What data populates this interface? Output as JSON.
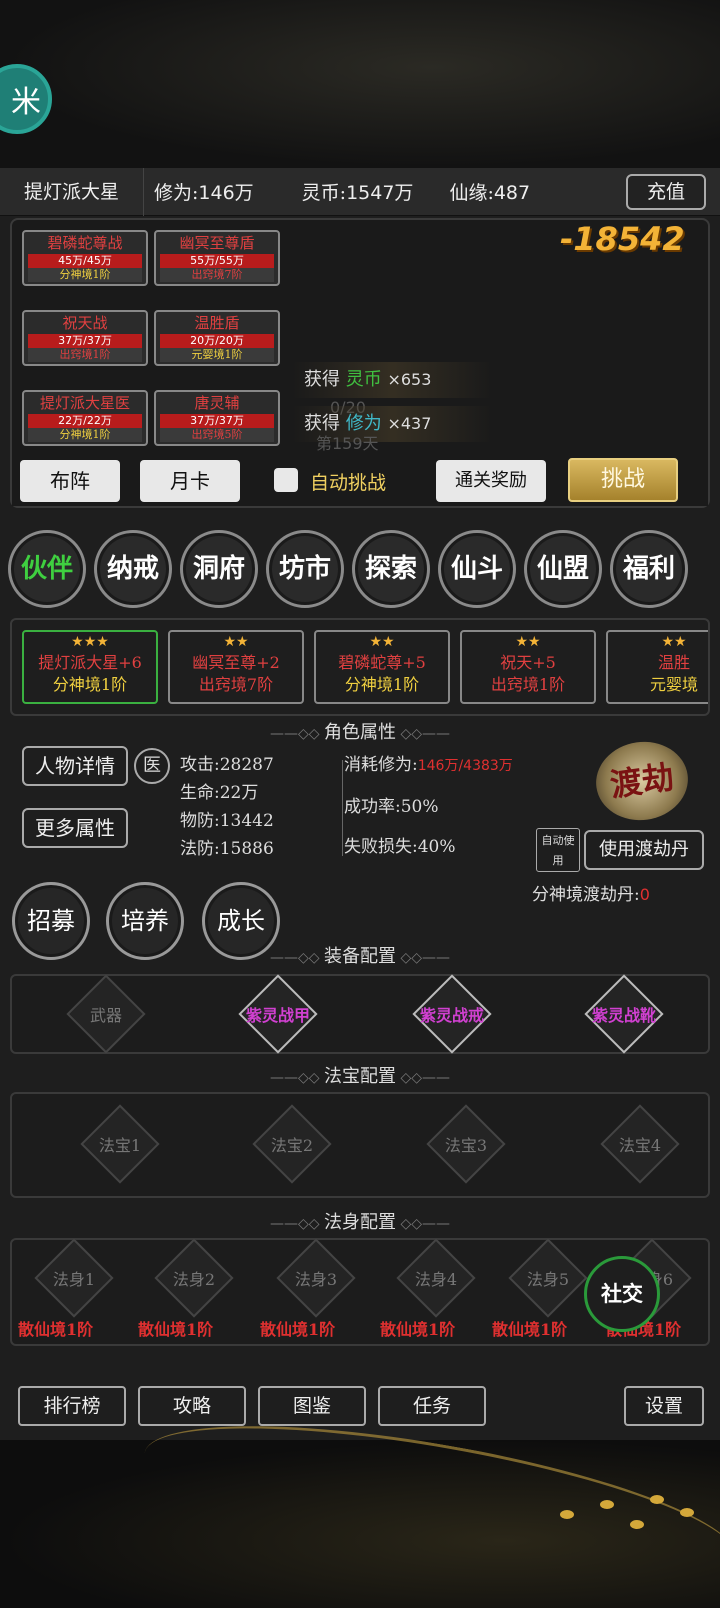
{
  "topbar": {
    "name": "提灯派大星",
    "cultivation_label": "修为:",
    "cultivation": "146万",
    "coins_label": "灵币:",
    "coins": "1547万",
    "luck_label": "仙缘:",
    "luck": "487",
    "recharge": "充值"
  },
  "battle": {
    "damage": "-18542",
    "units": [
      {
        "name": "碧磷蛇尊战",
        "hp": "45万/45万",
        "rank": "分神境1阶"
      },
      {
        "name": "幽冥至尊盾",
        "hp": "55万/55万",
        "rank": "出窍境7阶"
      },
      {
        "name": "祝天战",
        "hp": "37万/37万",
        "rank": "出窍境1阶"
      },
      {
        "name": "温胜盾",
        "hp": "20万/20万",
        "rank": "元婴境1阶"
      },
      {
        "name": "提灯派大星医",
        "hp": "22万/22万",
        "rank": "分神境1阶"
      },
      {
        "name": "唐灵辅",
        "hp": "37万/37万",
        "rank": "出窍境5阶"
      }
    ],
    "gains": [
      {
        "prefix": "获得",
        "res": "灵币",
        "amount": "×653"
      },
      {
        "prefix": "获得",
        "res": "修为",
        "amount": "×437"
      }
    ],
    "progress": "0/20",
    "day": "第159天",
    "formation": "布阵",
    "monthcard": "月卡",
    "auto_challenge": "自动挑战",
    "clear_reward": "通关奖励",
    "challenge": "挑战"
  },
  "nav": [
    "伙伴",
    "纳戒",
    "洞府",
    "坊市",
    "探索",
    "仙斗",
    "仙盟",
    "福利"
  ],
  "partners": [
    {
      "stars": "★★★",
      "name": "提灯派大星+6",
      "rank": "分神境1阶"
    },
    {
      "stars": "★★",
      "name": "幽冥至尊+2",
      "rank": "出窍境7阶"
    },
    {
      "stars": "★★",
      "name": "碧磷蛇尊+5",
      "rank": "分神境1阶"
    },
    {
      "stars": "★★",
      "name": "祝天+5",
      "rank": "出窍境1阶"
    },
    {
      "stars": "★★",
      "name": "温胜",
      "rank": "元婴境"
    }
  ],
  "attributes": {
    "title": "角色属性",
    "detail_btn": "人物详情",
    "role_icon": "医",
    "more_btn": "更多属性",
    "attack": "攻击:28287",
    "life": "生命:22万",
    "pdef": "物防:13442",
    "mdef": "法防:15886",
    "consume_label": "消耗修为:",
    "consume_value": "146万/4383万",
    "success": "成功率:50%",
    "fail": "失败损失:40%",
    "dujie": "渡劫",
    "auto_use": "自动使用",
    "use_pill": "使用渡劫丹",
    "pill_label": "分神境渡劫丹:",
    "pill_count": "0",
    "actions": [
      "招募",
      "培养",
      "成长"
    ]
  },
  "equipment": {
    "title": "装备配置",
    "slots": [
      "武器",
      "紫灵战甲",
      "紫灵战戒",
      "紫灵战靴"
    ]
  },
  "treasure": {
    "title": "法宝配置",
    "slots": [
      "法宝1",
      "法宝2",
      "法宝3",
      "法宝4"
    ]
  },
  "body": {
    "title": "法身配置",
    "slots": [
      "法身1",
      "法身2",
      "法身3",
      "法身4",
      "法身5",
      "法身6"
    ],
    "ranks": [
      "散仙境1阶",
      "散仙境1阶",
      "散仙境1阶",
      "散仙境1阶",
      "散仙境1阶",
      "散仙境1阶"
    ]
  },
  "social": "社交",
  "bottom": [
    "排行榜",
    "攻略",
    "图鉴",
    "任务",
    "设置"
  ],
  "colors": {
    "gold": "#f3b337",
    "green": "#3fd040",
    "red": "#e03030",
    "purple": "#d040d0"
  }
}
